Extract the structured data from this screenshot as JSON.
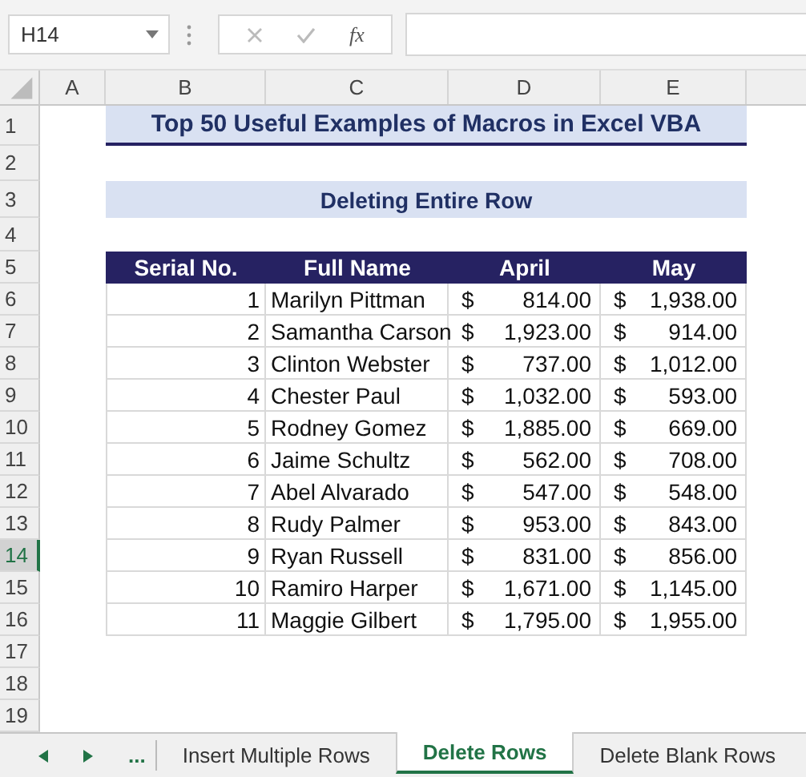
{
  "name_box": {
    "value": "H14"
  },
  "formula_bar": {
    "function_label": "fx"
  },
  "column_headers": [
    "A",
    "B",
    "C",
    "D",
    "E"
  ],
  "row_headers": [
    {
      "label": "1",
      "selected": false
    },
    {
      "label": "2",
      "selected": false
    },
    {
      "label": "3",
      "selected": false
    },
    {
      "label": "4",
      "selected": false
    },
    {
      "label": "5",
      "selected": false
    },
    {
      "label": "6",
      "selected": false
    },
    {
      "label": "7",
      "selected": false
    },
    {
      "label": "8",
      "selected": false
    },
    {
      "label": "9",
      "selected": false
    },
    {
      "label": "10",
      "selected": false
    },
    {
      "label": "11",
      "selected": false
    },
    {
      "label": "12",
      "selected": false
    },
    {
      "label": "13",
      "selected": false
    },
    {
      "label": "14",
      "selected": true
    },
    {
      "label": "15",
      "selected": false
    },
    {
      "label": "16",
      "selected": false
    },
    {
      "label": "17",
      "selected": false
    },
    {
      "label": "18",
      "selected": false
    },
    {
      "label": "19",
      "selected": false
    }
  ],
  "title": "Top 50 Useful Examples of Macros in Excel VBA",
  "subtitle": "Deleting Entire Row",
  "table": {
    "columns": [
      "Serial No.",
      "Full Name",
      "April",
      "May"
    ],
    "rows": [
      {
        "serial": "1",
        "name": "Marilyn Pittman",
        "april": {
          "currency": "$",
          "amount": "814.00"
        },
        "may": {
          "currency": "$",
          "amount": "1,938.00"
        }
      },
      {
        "serial": "2",
        "name": "Samantha Carson",
        "april": {
          "currency": "$",
          "amount": "1,923.00"
        },
        "may": {
          "currency": "$",
          "amount": "914.00"
        }
      },
      {
        "serial": "3",
        "name": "Clinton Webster",
        "april": {
          "currency": "$",
          "amount": "737.00"
        },
        "may": {
          "currency": "$",
          "amount": "1,012.00"
        }
      },
      {
        "serial": "4",
        "name": "Chester Paul",
        "april": {
          "currency": "$",
          "amount": "1,032.00"
        },
        "may": {
          "currency": "$",
          "amount": "593.00"
        }
      },
      {
        "serial": "5",
        "name": "Rodney Gomez",
        "april": {
          "currency": "$",
          "amount": "1,885.00"
        },
        "may": {
          "currency": "$",
          "amount": "669.00"
        }
      },
      {
        "serial": "6",
        "name": "Jaime Schultz",
        "april": {
          "currency": "$",
          "amount": "562.00"
        },
        "may": {
          "currency": "$",
          "amount": "708.00"
        }
      },
      {
        "serial": "7",
        "name": "Abel Alvarado",
        "april": {
          "currency": "$",
          "amount": "547.00"
        },
        "may": {
          "currency": "$",
          "amount": "548.00"
        }
      },
      {
        "serial": "8",
        "name": "Rudy Palmer",
        "april": {
          "currency": "$",
          "amount": "953.00"
        },
        "may": {
          "currency": "$",
          "amount": "843.00"
        }
      },
      {
        "serial": "9",
        "name": "Ryan Russell",
        "april": {
          "currency": "$",
          "amount": "831.00"
        },
        "may": {
          "currency": "$",
          "amount": "856.00"
        }
      },
      {
        "serial": "10",
        "name": "Ramiro Harper",
        "april": {
          "currency": "$",
          "amount": "1,671.00"
        },
        "may": {
          "currency": "$",
          "amount": "1,145.00"
        }
      },
      {
        "serial": "11",
        "name": "Maggie Gilbert",
        "april": {
          "currency": "$",
          "amount": "1,795.00"
        },
        "may": {
          "currency": "$",
          "amount": "1,955.00"
        }
      }
    ]
  },
  "tab_nav": {
    "more": "..."
  },
  "sheet_tabs": [
    {
      "label": "Insert Multiple Rows",
      "selected": false
    },
    {
      "label": "Delete Rows",
      "selected": true
    },
    {
      "label": "Delete Blank Rows",
      "selected": false
    }
  ]
}
